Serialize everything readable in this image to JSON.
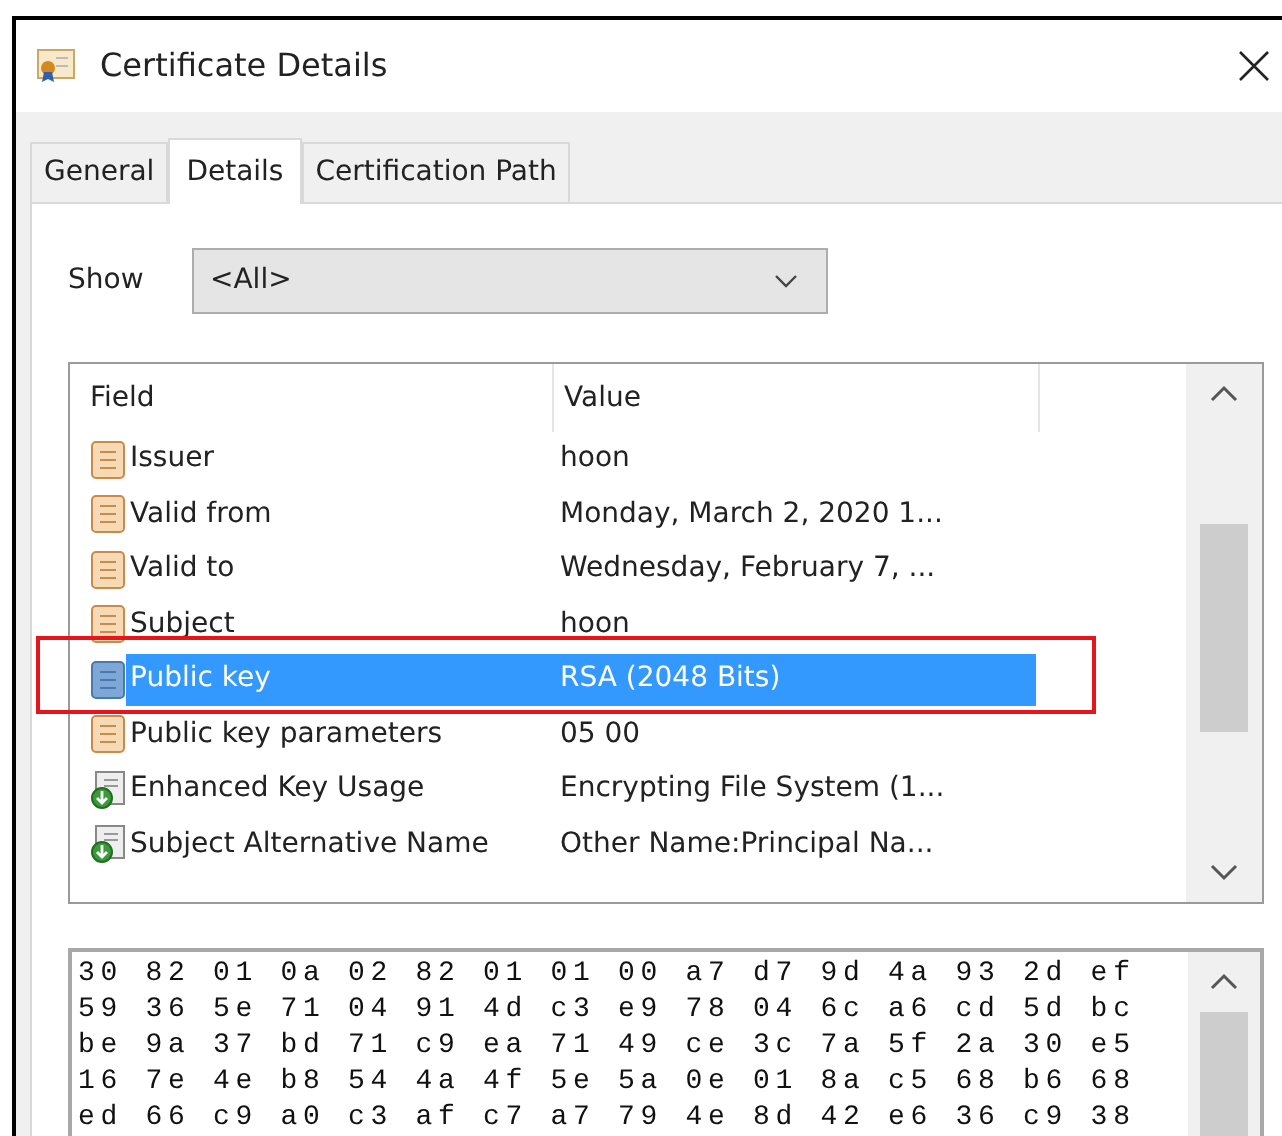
{
  "window": {
    "title": "Certificate Details"
  },
  "tabs": [
    {
      "label": "General",
      "selected": false
    },
    {
      "label": "Details",
      "selected": true
    },
    {
      "label": "Certification Path",
      "selected": false
    }
  ],
  "show": {
    "label": "Show",
    "value": "<All>"
  },
  "table": {
    "columns": [
      "Field",
      "Value"
    ],
    "rows": [
      {
        "kind": "property",
        "field": "Issuer",
        "value": "hoon",
        "selected": false
      },
      {
        "kind": "property",
        "field": "Valid from",
        "value": "Monday, March 2, 2020 1...",
        "selected": false
      },
      {
        "kind": "property",
        "field": "Valid to",
        "value": "Wednesday, February 7, ...",
        "selected": false
      },
      {
        "kind": "property",
        "field": "Subject",
        "value": "hoon",
        "selected": false
      },
      {
        "kind": "property",
        "field": "Public key",
        "value": "RSA (2048 Bits)",
        "selected": true
      },
      {
        "kind": "property",
        "field": "Public key parameters",
        "value": "05 00",
        "selected": false
      },
      {
        "kind": "extension",
        "field": "Enhanced Key Usage",
        "value": "Encrypting File System (1...",
        "selected": false
      },
      {
        "kind": "extension",
        "field": "Subject Alternative Name",
        "value": "Other Name:Principal Na...",
        "selected": false
      }
    ]
  },
  "value_lines": [
    "30 82 01 0a 02 82 01 01 00 a7 d7 9d 4a 93 2d ef",
    "59 36 5e 71 04 91 4d c3 e9 78 04 6c a6 cd 5d bc",
    "be 9a 37 bd 71 c9 ea 71 49 ce 3c 7a 5f 2a 30 e5",
    "16 7e 4e b8 54 4a 4f 5e 5a 0e 01 8a c5 68 b6 68",
    "ed 66 c9 a0 c3 af c7 a7 79 4e 8d 42 e6 36 c9 38"
  ]
}
